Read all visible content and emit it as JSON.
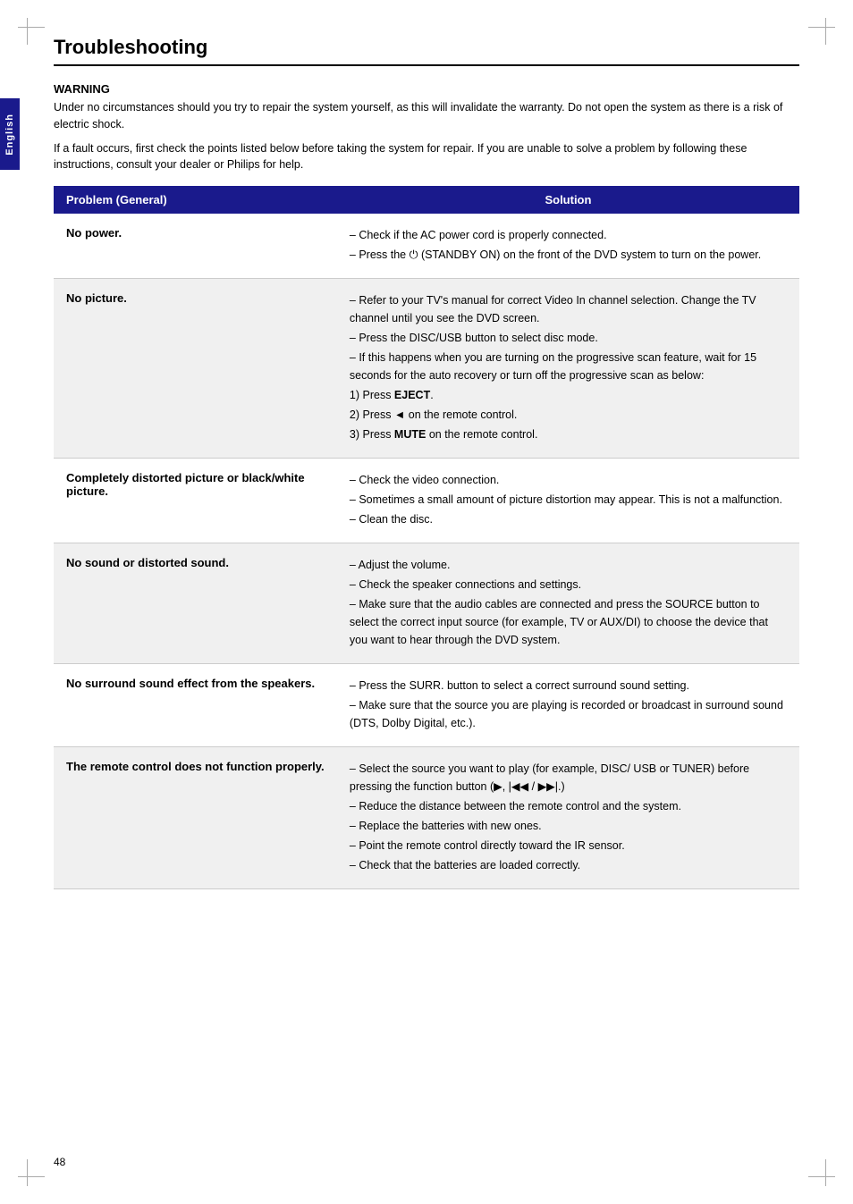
{
  "page": {
    "title": "Troubleshooting",
    "page_number": "48",
    "side_tab": "English"
  },
  "warning": {
    "label": "WARNING",
    "text1": "Under no circumstances should you try to repair the system yourself, as this will invalidate the warranty. Do not open the system as there is a risk of electric shock.",
    "text2": "If a fault occurs, first check the points listed below before taking the system for repair. If you are unable to solve a problem by following these instructions, consult your dealer or Philips for help."
  },
  "table": {
    "col_problem": "Problem (General)",
    "col_solution": "Solution",
    "rows": [
      {
        "problem": "No power.",
        "solutions": [
          "– Check if the AC power cord is properly connected.",
          "– Press the ⏻ (STANDBY ON) on the front of the DVD system to turn on the power."
        ]
      },
      {
        "problem": "No picture.",
        "solutions": [
          "– Refer to your TV's manual for correct Video In channel selection. Change the TV channel until you see the DVD screen.",
          "– Press the DISC/USB button to select disc mode.",
          "– If this happens when you are turning on the progressive scan feature, wait for 15 seconds for the auto recovery or turn off the progressive scan as below:",
          "1) Press EJECT.",
          "2) Press ◄ on the remote control.",
          "3) Press MUTE on the remote control."
        ]
      },
      {
        "problem": "Completely distorted picture or black/white picture.",
        "solutions": [
          "– Check the video connection.",
          "– Sometimes a small amount of picture distortion may appear. This is not a malfunction.",
          "– Clean the disc."
        ]
      },
      {
        "problem": "No sound or distorted sound.",
        "solutions": [
          "– Adjust the volume.",
          "– Check the speaker connections and settings.",
          "– Make sure that the audio cables are connected and press the SOURCE button to select the correct input source (for example, TV or AUX/DI) to choose the device that you want to hear through the DVD system."
        ]
      },
      {
        "problem": "No surround sound effect from the speakers.",
        "solutions": [
          "– Press the SURR. button to select a correct surround sound setting.",
          "– Make sure that the source you are playing is recorded or broadcast in surround sound (DTS, Dolby Digital, etc.)."
        ]
      },
      {
        "problem": "The remote control does not function properly.",
        "solutions": [
          "– Select the source you want to play (for example, DISC/ USB or TUNER) before pressing the function button (▶, |◀◀ / ▶▶|.)",
          "– Reduce the distance between the remote control and the system.",
          "– Replace the batteries with new ones.",
          "– Point the remote control directly toward the IR sensor.",
          "– Check that the batteries are loaded correctly."
        ]
      }
    ]
  }
}
